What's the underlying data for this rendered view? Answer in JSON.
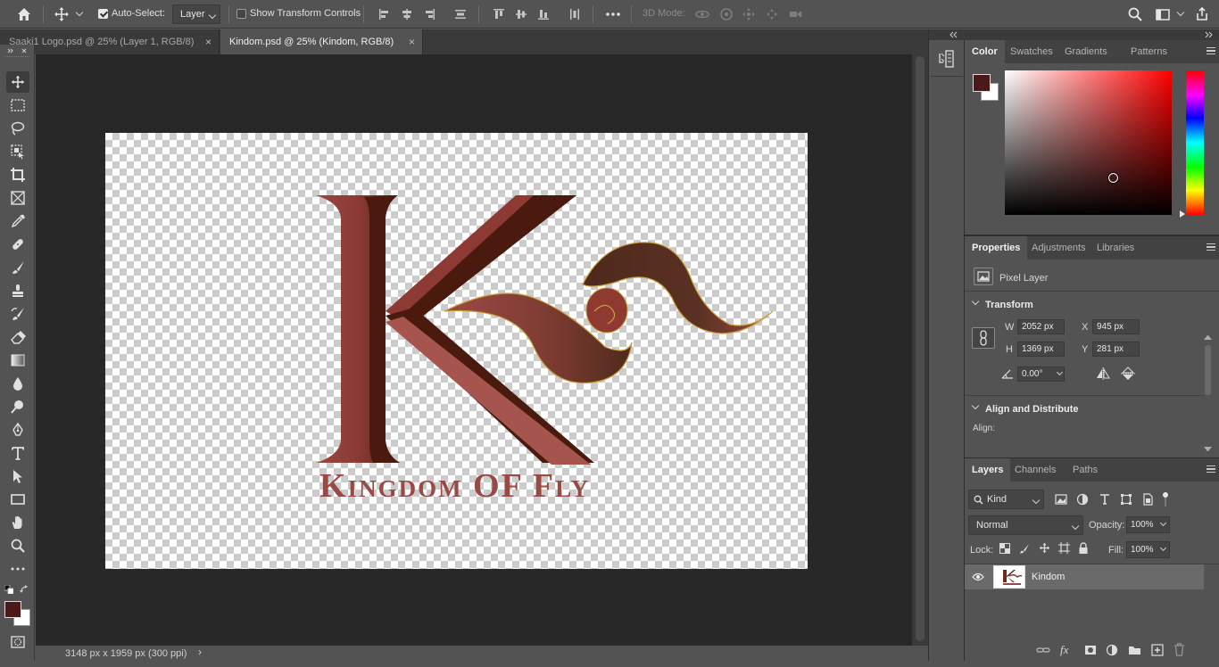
{
  "options_bar": {
    "auto_select_label": "Auto-Select:",
    "auto_select_value": "Layer",
    "transform_controls_label": "Show Transform Controls",
    "three_d_mode_label": "3D Mode:"
  },
  "tabs": [
    {
      "label": "Saaki1 Logo.psd @ 25% (Layer 1, RGB/8)",
      "close": "×"
    },
    {
      "label": "Kindom.psd @ 25% (Kindom, RGB/8)",
      "close": "×"
    }
  ],
  "status_bar": {
    "doc_info": "3148 px x 1959 px (300 ppi)"
  },
  "artwork": {
    "logo_text": "Kingdom OF Fly",
    "colors": {
      "dark": "#4a1a0e",
      "mid": "#8e3a34",
      "light": "#a5544e",
      "wing": "#4e2a1c",
      "outline": "#c8a040"
    }
  },
  "color_panel": {
    "tabs": [
      "Color",
      "Swatches",
      "Gradients",
      "Patterns"
    ],
    "foreground": "#4a1a1a",
    "background": "#ffffff"
  },
  "properties_panel": {
    "tabs": [
      "Properties",
      "Adjustments",
      "Libraries"
    ],
    "layer_type": "Pixel Layer",
    "transform_label": "Transform",
    "w_label": "W",
    "w_value": "2052 px",
    "h_label": "H",
    "h_value": "1369 px",
    "x_label": "X",
    "x_value": "945 px",
    "y_label": "Y",
    "y_value": "281 px",
    "angle_value": "0.00°",
    "align_label": "Align and Distribute",
    "align_sub": "Align:"
  },
  "layers_panel": {
    "tabs": [
      "Layers",
      "Channels",
      "Paths"
    ],
    "filter_kind": "Kind",
    "blend_mode": "Normal",
    "opacity_label": "Opacity:",
    "opacity_value": "100%",
    "lock_label": "Lock:",
    "fill_label": "Fill:",
    "fill_value": "100%",
    "layers": [
      {
        "name": "Kindom",
        "visible": true
      }
    ]
  }
}
